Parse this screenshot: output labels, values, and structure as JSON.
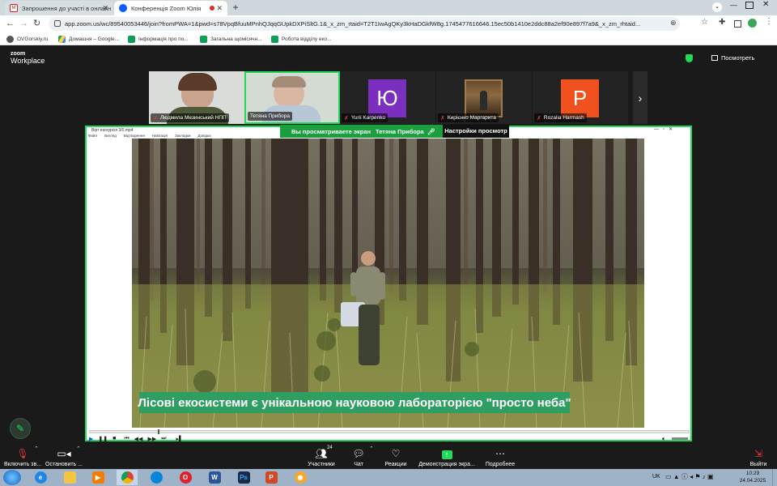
{
  "browser": {
    "tabs": [
      {
        "title": "Запрошення до участі в онлайн",
        "active": false
      },
      {
        "title": "Конференція Zoom Юлія",
        "active": true
      }
    ],
    "url": "app.zoom.us/wc/89540053446/join?fromPWA=1&pwd=s78VpqBfuuMPnhQJqqGUpkDXPiSltG.1&_x_zm_rtaid=T2T1IwAgQKy3kHaDGkfW8g.1745477616646.15ec50b1410e2ddc88a2ef90e897f7a9&_x_zm_rhtaid...",
    "bookmarks": [
      {
        "label": "OVGorskiy.ru",
        "icon": "globe-icon"
      },
      {
        "label": "Домашня – Google...",
        "icon": "drive-icon"
      },
      {
        "label": "Інформація про по...",
        "icon": "sheets-icon"
      },
      {
        "label": "Загальна щомісячн...",
        "icon": "sheets-icon"
      },
      {
        "label": "Робота відділу еко...",
        "icon": "sheets-icon"
      }
    ]
  },
  "zoom": {
    "logo_top": "zoom",
    "logo_bottom": "Workplace",
    "view_label": "Посмотреть",
    "participants": [
      {
        "name": "Людмила Мезинський НПП",
        "muted": true,
        "type": "video"
      },
      {
        "name": "Тетяна Прибора",
        "muted": false,
        "type": "video"
      },
      {
        "name": "Yurii Karpenko",
        "muted": true,
        "type": "avatar",
        "letter": "Ю",
        "color": "#7b2fbe"
      },
      {
        "name": "Кирієнко Маргарита",
        "muted": true,
        "type": "photo"
      },
      {
        "name": "Rozalia Harmash",
        "muted": true,
        "type": "avatar",
        "letter": "P",
        "color": "#f0511f"
      }
    ],
    "share_banner": {
      "viewing": "Вы просматриваете экран",
      "presenter": "Тетяна Прибора",
      "settings": "Настройки просмотр"
    },
    "player": {
      "window_title": "Вірт екскурсія 3/0.mp4",
      "menu": [
        "Файл",
        "Вигляд",
        "Відтворення",
        "Навігація",
        "Закладки",
        "Довідка"
      ]
    },
    "caption": "Лісові екосистеми є унікальною науковою лабораторією \"просто неба\"",
    "toolbar": {
      "mic": "Включить зв...",
      "video": "Остановить ...",
      "participants": "Участники",
      "participants_count": "24",
      "chat": "Чат",
      "reactions": "Реакции",
      "share": "Демонстрация экра...",
      "more": "Подробнее",
      "leave": "Выйти"
    }
  },
  "taskbar": {
    "lang": "UK",
    "time": "10:29",
    "date": "24.04.2025"
  },
  "colors": {
    "share_border": "#23d959",
    "caption_bg": "#2f9e63",
    "zoom_bg": "#1a1a1a"
  }
}
